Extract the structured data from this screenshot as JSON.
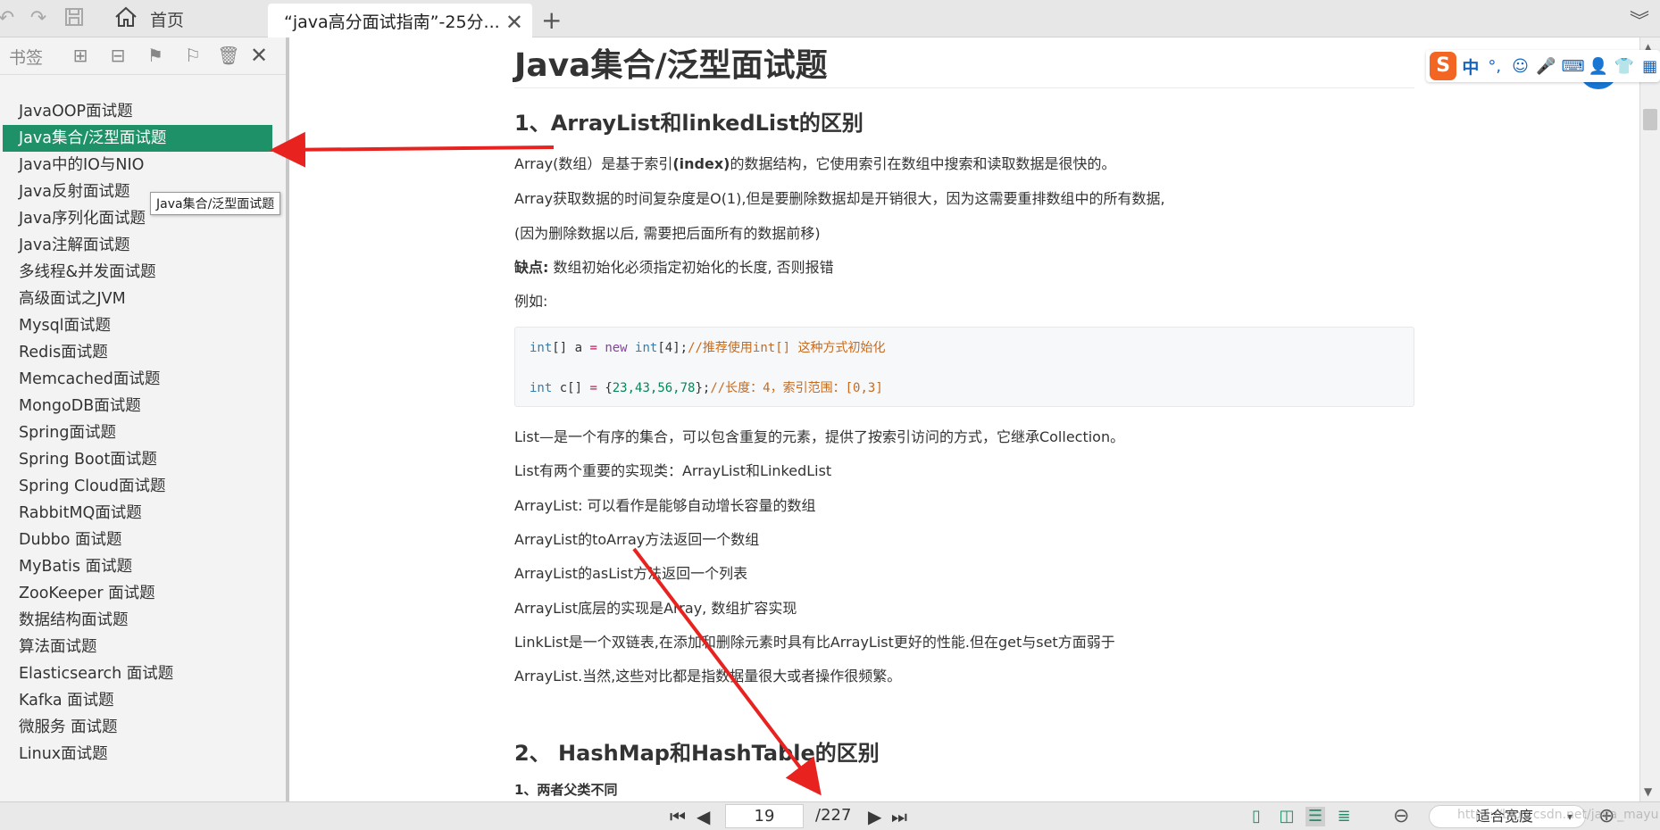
{
  "tabs": {
    "home_label": "首页",
    "doc_label": "“java高分面试指南”-25分..."
  },
  "icons": {
    "undo": "undo-icon",
    "redo": "redo-icon",
    "save": "save-icon",
    "home": "home-icon",
    "close": "close-icon",
    "add": "plus-icon",
    "menu": "chevron-down-icon"
  },
  "sidebar": {
    "title": "书签",
    "tooltip": "Java集合/泛型面试题",
    "items": [
      {
        "label": "JavaOOP面试题"
      },
      {
        "label": "Java集合/泛型面试题",
        "active": true
      },
      {
        "label": "Java中的IO与NIO"
      },
      {
        "label": "Java反射面试题"
      },
      {
        "label": "Java序列化面试题"
      },
      {
        "label": "Java注解面试题"
      },
      {
        "label": "多线程&并发面试题"
      },
      {
        "label": "高级面试之JVM"
      },
      {
        "label": "Mysql面试题"
      },
      {
        "label": "Redis面试题"
      },
      {
        "label": "Memcached面试题"
      },
      {
        "label": "MongoDB面试题"
      },
      {
        "label": "Spring面试题"
      },
      {
        "label": "Spring Boot面试题"
      },
      {
        "label": "Spring Cloud面试题"
      },
      {
        "label": "RabbitMQ面试题"
      },
      {
        "label": "Dubbo 面试题"
      },
      {
        "label": "MyBatis 面试题"
      },
      {
        "label": "ZooKeeper 面试题"
      },
      {
        "label": "数据结构面试题"
      },
      {
        "label": "算法面试题"
      },
      {
        "label": "Elasticsearch 面试题"
      },
      {
        "label": "Kafka 面试题"
      },
      {
        "label": "微服务 面试题"
      },
      {
        "label": "Linux面试题"
      }
    ]
  },
  "doc": {
    "title": "Java集合/泛型面试题",
    "section1": "1、ArrayList和linkedList的区别",
    "p1_a": "Array(数组）是基于索引",
    "p1_b": "(index)",
    "p1_c": "的数据结构，它使用索引在数组中搜索和读取数据是很快的。",
    "p2": "Array获取数据的时间复杂度是O(1),但是要删除数据却是开销很大，因为这需要重排数组中的所有数据,",
    "p3": "(因为删除数据以后, 需要把后面所有的数据前移)",
    "p4_label": "缺点:",
    "p4_text": " 数组初始化必须指定初始化的长度, 否则报错",
    "p5": "例如:",
    "code1": {
      "type": "int",
      "rest": "[] a ",
      "eq": "=",
      "kw": " new ",
      "type2": "int",
      "rest2": "[4];",
      "comment": "//推荐使用int[] 这种方式初始化"
    },
    "code2": {
      "type": "int",
      "rest": " c[] ",
      "eq": "=",
      "rest2": " {",
      "nums": "23,43,56,78",
      "rest3": "};",
      "comment": "//长度：4，索引范围：[0,3]"
    },
    "p6": "List—是一个有序的集合，可以包含重复的元素，提供了按索引访问的方式，它继承Collection。",
    "p7": "List有两个重要的实现类：ArrayList和LinkedList",
    "p8": "ArrayList: 可以看作是能够自动增长容量的数组",
    "p9": "ArrayList的toArray方法返回一个数组",
    "p10": "ArrayList的asList方法返回一个列表",
    "p11": "ArrayList底层的实现是Array, 数组扩容实现",
    "p12": "LinkList是一个双链表,在添加和删除元素时具有比ArrayList更好的性能.但在get与set方面弱于",
    "p13": "ArrayList.当然,这些对比都是指数据量很大或者操作很频繁。",
    "section2": "2、 HashMap和HashTable的区别",
    "sub1": "1、两者父类不同"
  },
  "ime": {
    "logo": "S",
    "lang": "中"
  },
  "bottombar": {
    "current_page": "19",
    "total_pages": "/227",
    "zoom_label": "适合宽度",
    "watermark": "https://blog.csdn.net/java_mayu"
  },
  "colors": {
    "accent": "#1e9168",
    "arrow": "#e8231f"
  }
}
